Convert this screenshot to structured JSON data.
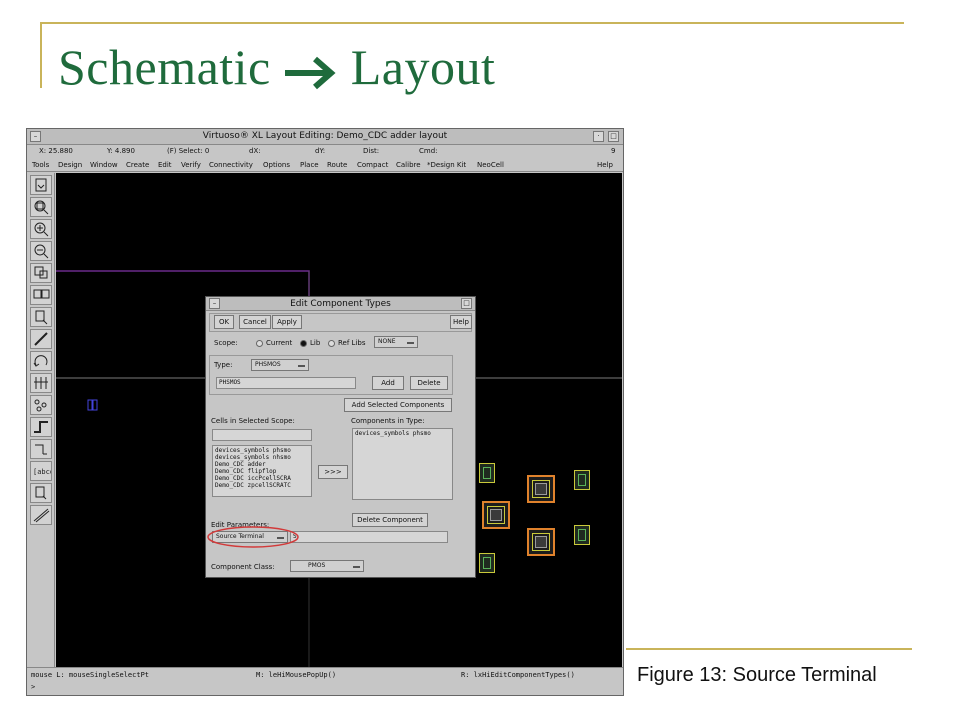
{
  "slide": {
    "title_left": "Schematic",
    "title_right": "Layout",
    "caption": "Figure 13: Source Terminal",
    "accent_color": "#1f6b3c",
    "deco_color": "#c9b45a"
  },
  "window": {
    "title": "Virtuoso® XL Layout Editing: Demo_CDC adder layout",
    "status": {
      "x": "X: 25.880",
      "y": "Y: 4.890",
      "select": "(F) Select: 0",
      "dx": "dX:",
      "dy": "dY:",
      "dist": "Dist:",
      "cmd": "Cmd:",
      "num": "9"
    },
    "menu": [
      "Tools",
      "Design",
      "Window",
      "Create",
      "Edit",
      "Verify",
      "Connectivity",
      "Options",
      "Place",
      "Route",
      "Compact",
      "Calibre",
      "*Design Kit",
      "NeoCell"
    ],
    "help": "Help",
    "toolbar_icons": [
      "save-icon",
      "zoom-fit-icon",
      "zoom-in-icon",
      "zoom-out-icon",
      "stretch-icon",
      "copy-icon",
      "move-icon",
      "ruler-icon",
      "undo-icon",
      "properties-icon",
      "hierarchy-icon",
      "wire-icon",
      "path-icon",
      "label-icon",
      "select-icon",
      "line-icon"
    ],
    "footer": {
      "left": "mouse L: mouseSingleSelectPt",
      "mid": "M: leHiMousePopUp()",
      "right": "R: lxHiEditComponentTypes()",
      "prompt": ">"
    }
  },
  "dialog": {
    "title": "Edit Component Types",
    "ok": "OK",
    "cancel": "Cancel",
    "apply": "Apply",
    "help": "Help",
    "scope_label": "Scope:",
    "scope_options": [
      "Current",
      "Lib",
      "Ref Libs"
    ],
    "scope_selected": "Lib",
    "none_value": "NONE",
    "type_label": "Type:",
    "type_value": "PHSMOS",
    "type_field": "PHSMOS",
    "add": "Add",
    "delete": "Delete",
    "add_selected": "Add Selected Components",
    "cells_label": "Cells in Selected Scope:",
    "cells_filter": "",
    "cells": [
      "devices_symbols phsmo",
      "devices_symbols nhsmo",
      "Demo_CDC adder",
      "Demo_CDC flipflop",
      "Demo_CDC iccPcellSCRA",
      "Demo_CDC zpcellSCRATC"
    ],
    "move_btn": ">>>",
    "components_label": "Components in Type:",
    "components": [
      "devices_symbols phsmo"
    ],
    "delete_component": "Delete Component",
    "edit_params_label": "Edit Parameters:",
    "source_terminal": "Source Terminal",
    "source_value": "S",
    "class_label": "Component Class:",
    "class_value": "PMOS"
  }
}
